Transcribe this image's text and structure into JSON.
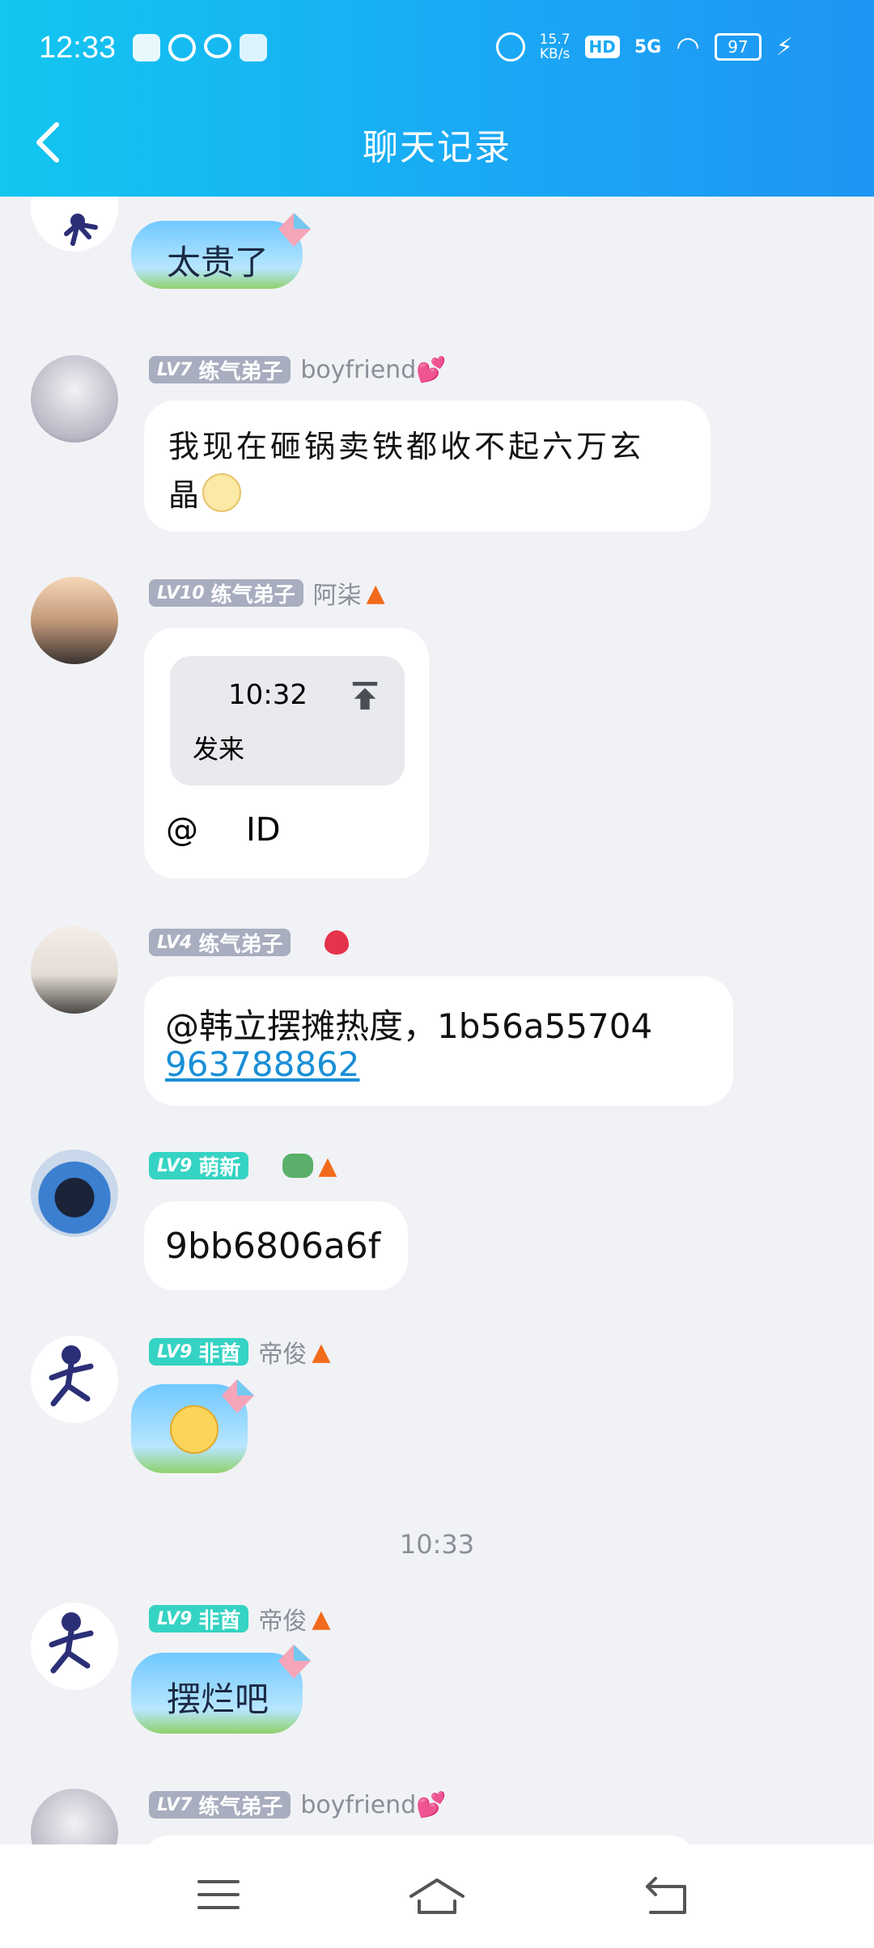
{
  "status_bar": {
    "time": "12:33",
    "net_speed": "15.7",
    "net_unit": "KB/s",
    "hd": "HD",
    "network": "5G",
    "battery": "97"
  },
  "header": {
    "title": "聊天记录"
  },
  "messages": [
    {
      "text": "太贵了"
    },
    {
      "level": "LV7",
      "rank": "练气弟子",
      "nick": "boyfriend💕",
      "text_line1": "我现在砸锅卖铁都收不起六万玄",
      "text_line2": "晶"
    },
    {
      "level": "LV10",
      "rank": "练气弟子",
      "nick": "阿柒",
      "quote_time": "10:32",
      "quote_text": "发来",
      "at": "@",
      "id_text": "ID"
    },
    {
      "level": "LV4",
      "rank": "练气弟子",
      "text_line1": "@韩立摆摊热度，1b56a55704",
      "link": "963788862"
    },
    {
      "level": "LV9",
      "rank": "萌新",
      "text": "9bb6806a6f"
    },
    {
      "level": "LV9",
      "rank": "非酋",
      "nick": "帝俊"
    },
    {
      "level": "LV9",
      "rank": "非酋",
      "nick": "帝俊",
      "text": "摆烂吧"
    },
    {
      "level": "LV7",
      "rank": "练气弟子",
      "nick": "boyfriend💕"
    }
  ],
  "divider_time": "10:33",
  "colors": {
    "header_start": "#12c6f0",
    "header_end": "#1e95f3",
    "badge_gray": "#a8adbf",
    "badge_teal": "#35d3c3",
    "link": "#1a8fd6"
  }
}
